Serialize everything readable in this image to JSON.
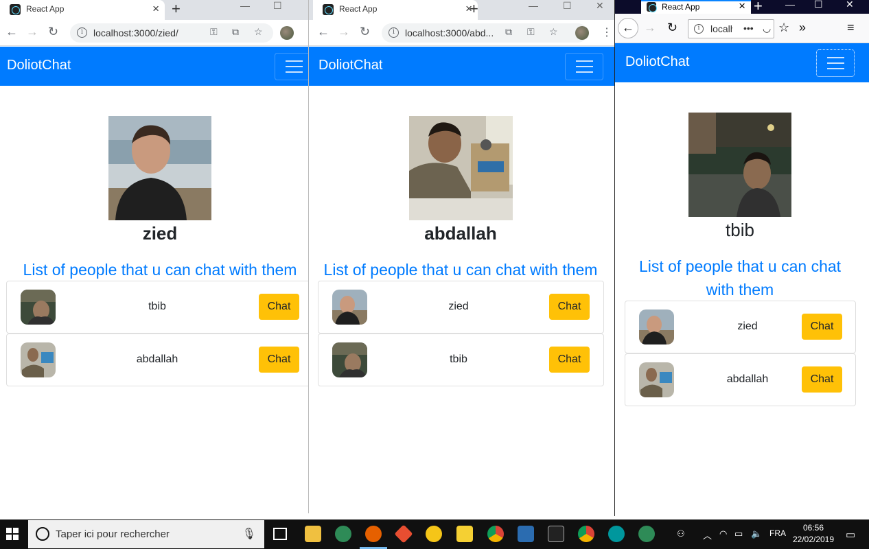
{
  "windows": [
    {
      "tab_title": "React App",
      "url": "localhost:3000/zied/",
      "brand": "DoliotChat",
      "user": "zied",
      "list_title": "List of people that u can chat with them",
      "people": [
        {
          "name": "tbib",
          "button": "Chat"
        },
        {
          "name": "abdallah",
          "button": "Chat"
        }
      ]
    },
    {
      "tab_title": "React App",
      "url": "localhost:3000/abd...",
      "brand": "DoliotChat",
      "user": "abdallah",
      "list_title": "List of people that u can chat with them",
      "people": [
        {
          "name": "zied",
          "button": "Chat"
        },
        {
          "name": "tbib",
          "button": "Chat"
        }
      ]
    },
    {
      "tab_title": "React App",
      "url": "localho",
      "brand": "DoliotChat",
      "user": "tbib",
      "list_title": "List of people that u can chat with them",
      "people": [
        {
          "name": "zied",
          "button": "Chat"
        },
        {
          "name": "abdallah",
          "button": "Chat"
        }
      ]
    }
  ],
  "taskbar": {
    "search_placeholder": "Taper ici pour rechercher",
    "language": "FRA",
    "time": "06:56",
    "date": "22/02/2019"
  },
  "colors": {
    "navbar": "#007bff",
    "chat_button": "#ffc107",
    "list_title": "#007bff"
  },
  "icons": {
    "back": "arrow-left-icon",
    "forward": "arrow-right-icon",
    "reload": "reload-icon",
    "menu": "hamburger-icon"
  }
}
